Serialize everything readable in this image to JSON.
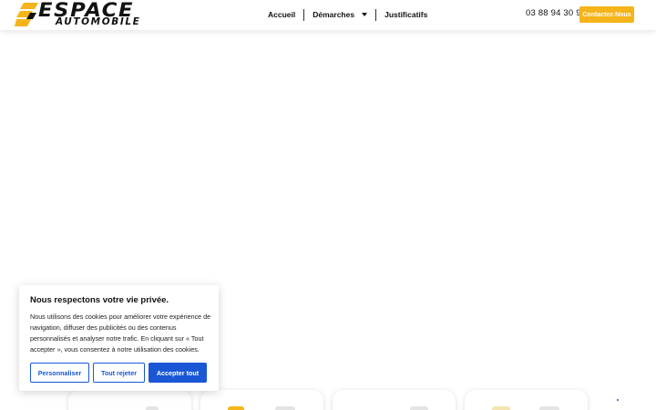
{
  "brand": {
    "name_line1": "ESPACE",
    "name_line2": "AUTOMOBILE",
    "accent": "#f5b41a"
  },
  "nav": {
    "items": [
      {
        "label": "Accueil"
      },
      {
        "label": "Démarches",
        "icon": "chevron-down-icon"
      },
      {
        "label": "Justificatifs"
      }
    ]
  },
  "header": {
    "phone": "03 88 94 30 95",
    "contact_label": "Contactez-Nous"
  },
  "cookie": {
    "title": "Nous respectons votre vie privée.",
    "text": "Nous utilisons des cookies pour améliorer votre expérience de navigation, diffuser des publicités ou des contenus personnalisés et analyser notre trafic. En cliquant sur « Tout accepter », vous consentez à notre utilisation des cookies.",
    "customize_label": "Personnaliser",
    "reject_label": "Tout rejeter",
    "accept_label": "Accepter tout",
    "button_color": "#1a57d6"
  }
}
